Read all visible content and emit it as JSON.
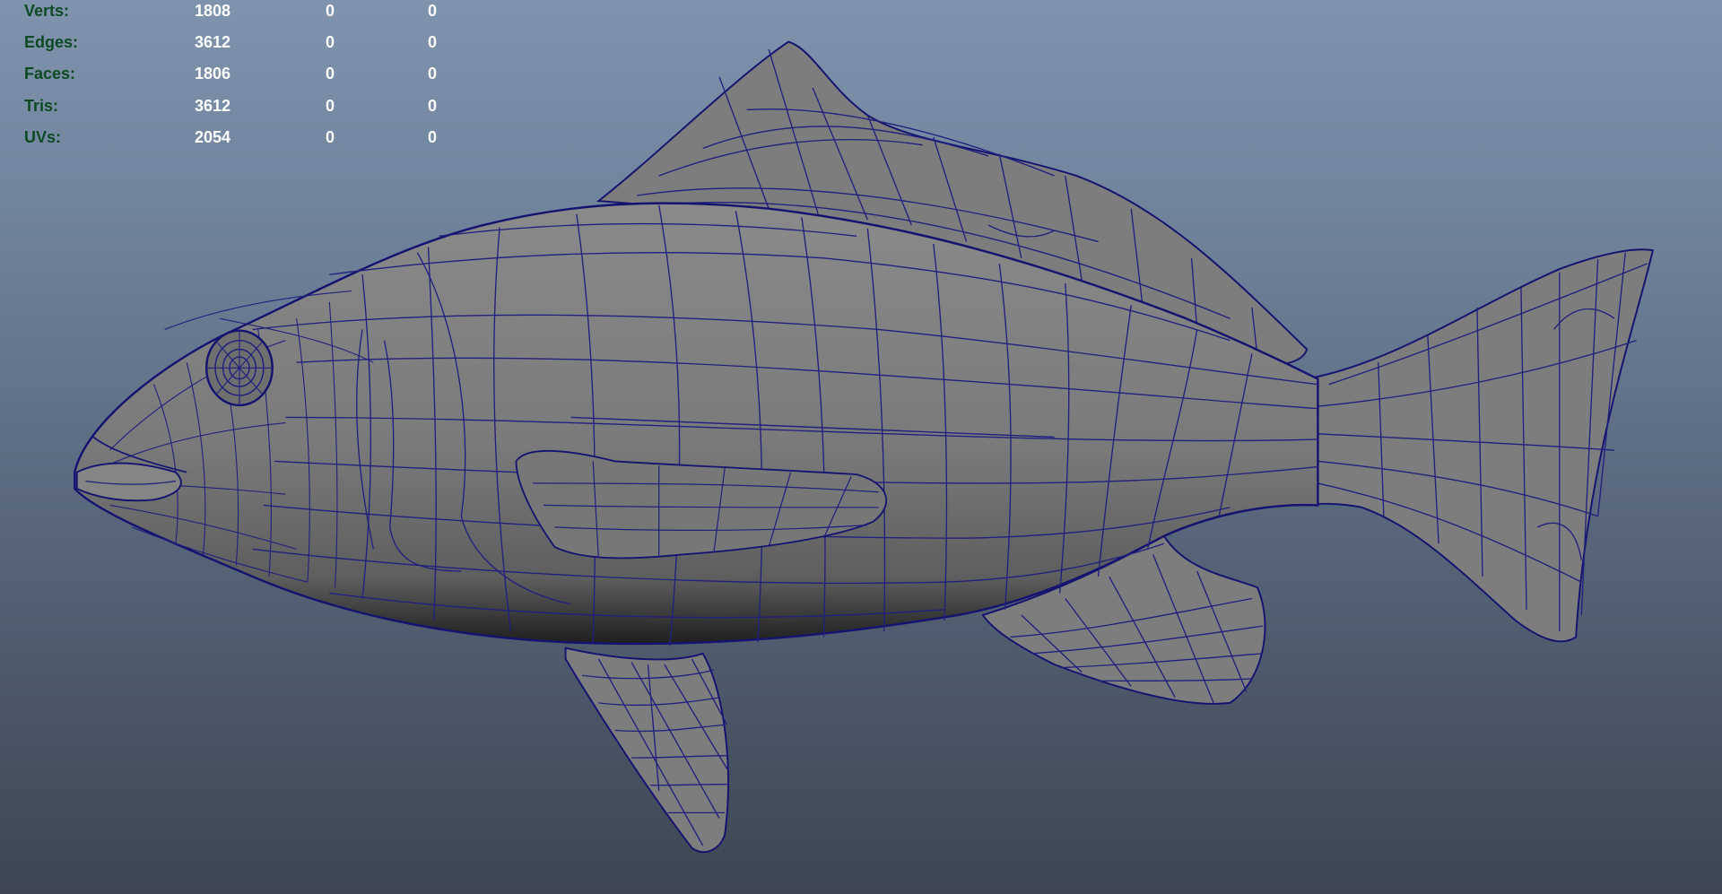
{
  "hud": {
    "rows": [
      {
        "label": "Verts:",
        "values": [
          "1808",
          "0",
          "0"
        ]
      },
      {
        "label": "Edges:",
        "values": [
          "3612",
          "0",
          "0"
        ]
      },
      {
        "label": "Faces:",
        "values": [
          "1806",
          "0",
          "0"
        ]
      },
      {
        "label": "Tris:",
        "values": [
          "3612",
          "0",
          "0"
        ]
      },
      {
        "label": "UVs:",
        "values": [
          "2054",
          "0",
          "0"
        ]
      }
    ],
    "label_color": "#0d4a24",
    "value_color": "#ffffff"
  },
  "viewport": {
    "background_top": "#7f93ad",
    "background_bottom": "#3d4652",
    "mesh_fill": "#7a7a7a",
    "wire_color": "#1a1a7a",
    "object": "fish-mesh"
  }
}
